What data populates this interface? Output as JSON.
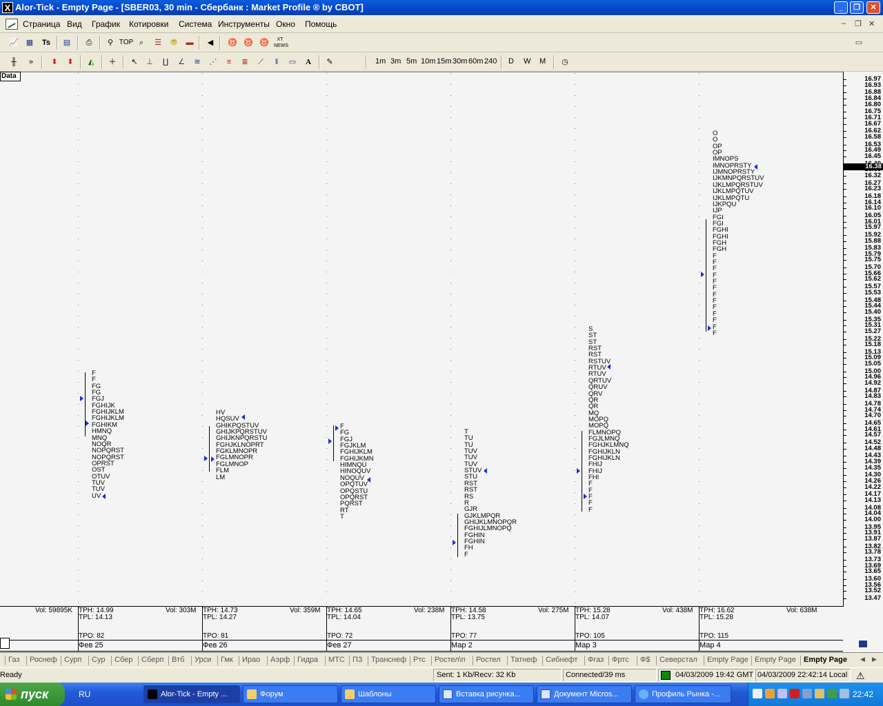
{
  "window": {
    "title": "Alor-Tick - Empty Page - [SBER03, 30 min - Сбербанк : Market Profile ® by CBOT]",
    "app_icon": "X"
  },
  "menu": [
    "Страница",
    "Вид",
    "График",
    "Котировки",
    "Система",
    "Инструменты",
    "Окно",
    "Помощь"
  ],
  "toolbar": {
    "top_label": "TOP",
    "timeframes": [
      "1m",
      "3m",
      "5m",
      "10m",
      "15m",
      "30m",
      "60m",
      "240",
      "D",
      "W",
      "M"
    ]
  },
  "chart": {
    "data_label": "Data",
    "price_labels": [
      "16.97",
      "16.93",
      "16.88",
      "16.84",
      "16.80",
      "16.75",
      "16.71",
      "16.67",
      "16.62",
      "16.58",
      "16.53",
      "16.49",
      "16.45",
      "16.40",
      "16.36",
      "16.32",
      "16.27",
      "16.23",
      "16.18",
      "16.14",
      "16.10",
      "16.05",
      "16.01",
      "15.97",
      "15.92",
      "15.88",
      "15.83",
      "15.79",
      "15.75",
      "15.70",
      "15.66",
      "15.62",
      "15.57",
      "15.53",
      "15.48",
      "15.44",
      "15.40",
      "15.35",
      "15.31",
      "15.27",
      "15.22",
      "15.18",
      "15.13",
      "15.09",
      "15.05",
      "15.00",
      "14.96",
      "14.92",
      "14.87",
      "14.83",
      "14.78",
      "14.74",
      "14.70",
      "14.65",
      "14.61",
      "14.57",
      "14.52",
      "14.48",
      "14.43",
      "14.39",
      "14.35",
      "14.30",
      "14.26",
      "14.22",
      "14.17",
      "14.13",
      "14.08",
      "14.04",
      "14.00",
      "13.95",
      "13.91",
      "13.87",
      "13.82",
      "13.78",
      "13.73",
      "13.69",
      "13.65",
      "13.60",
      "13.56",
      "13.52",
      "13.47"
    ],
    "current_price": "16.38",
    "profiles": [
      {
        "date": "Фев 25",
        "lines": [
          "F",
          "F",
          "FG",
          "FG",
          "FGJ",
          "FGHIJK",
          "FGHIJKLM",
          "FGHIJKLM",
          "FGHIKM",
          "HMNQ",
          "MNQ",
          "NOQR",
          "NOPQRST",
          "NOPQRST",
          "OPRST",
          "OST",
          "OTUV",
          "TUV",
          "TUV",
          "UV"
        ],
        "vol_day": "Vol: 59895K",
        "tph": "TPH: 14.99",
        "tpl": "TPL: 14.13",
        "vol": "Vol: 303M",
        "tpo": "TPO: 82"
      },
      {
        "date": "Фев 26",
        "lines": [
          "HV",
          "HQSUV",
          "GHIKPQSTUV",
          "GHIJKPQRSTUV",
          "GHIJKNPQRSTU",
          "FGHJKLNOPRT",
          "FGKLMNOPR",
          "FGLMNOPR",
          "FGLMNOP",
          "FLM",
          "LM"
        ],
        "tph": "TPH: 14.73",
        "tpl": "TPL: 14.27",
        "vol": "Vol: 359M",
        "tpo": "TPO: 81"
      },
      {
        "date": "Фев 27",
        "lines": [
          "F",
          "FG",
          "FGJ",
          "FGJKLM",
          "FGHIJKLM",
          "FGHIJKMN",
          "HIMNQU",
          "HINOQUV",
          "NOQUV",
          "OPQTUV",
          "OPQSTU",
          "OPQRST",
          "PQRST",
          "RT",
          "T"
        ],
        "tph": "TPH: 14.65",
        "tpl": "TPL: 14.04",
        "vol": "Vol: 238M",
        "tpo": "TPO: 72"
      },
      {
        "date": "Мар 2",
        "lines": [
          "T",
          "TU",
          "TU",
          "TUV",
          "TUV",
          "TUV",
          "STUV",
          "STU",
          "RST",
          "RST",
          "RS",
          "R",
          "GJR",
          "GJKLMPQR",
          "GHIJKLMNOPQR",
          "FGHIJLMNOPQ",
          "FGHIN",
          "FGHIN",
          "FH",
          "F"
        ],
        "tph": "TPH: 14.58",
        "tpl": "TPL: 13.75",
        "vol": "Vol: 275M",
        "tpo": "TPO: 77"
      },
      {
        "date": "Мар 3",
        "lines": [
          "S",
          "ST",
          "ST",
          "RST",
          "RST",
          "RSTUV",
          "RTUV",
          "RTUV",
          "QRTUV",
          "QRUV",
          "QRV",
          "QR",
          "QR",
          "MQ",
          "MOPQ",
          "MOPQ",
          "FLMNOPQ",
          "FGJLMNQ",
          "FGHJKLMNQ",
          "FGHIJKLN",
          "FGHIJKLN",
          "FHIJ",
          "FHIJ",
          "FHI",
          "F",
          "F",
          "F",
          "F",
          "F"
        ],
        "tph": "TPH: 15.28",
        "tpl": "TPL: 14.07",
        "vol": "Vol: 438M",
        "tpo": "TPO: 105"
      },
      {
        "date": "Мар 4",
        "lines": [
          "O",
          "O",
          "OP",
          "OP",
          "IMNOPS",
          "IMNOPRSTY",
          "IJMNOPRSTY",
          "IJKMNPQRSTUV",
          "IJKLMPQRSTUV",
          "IJKLMPQTUV",
          "IJKLMPQTU",
          "IJKPQU",
          "IJP",
          "FGI",
          "FGI",
          "FGHI",
          "FGHI",
          "FGH",
          "FGH",
          "F",
          "F",
          "F",
          "F",
          "F",
          "F",
          "F",
          "F",
          "F",
          "F",
          "F",
          "F",
          "F"
        ],
        "tph": "TPH: 16.62",
        "tpl": "TPL: 15.28",
        "vol": "Vol: 638M",
        "tpo": "TPO: 115"
      }
    ]
  },
  "tabs": [
    "Газ",
    "Роснеф",
    "Сурп",
    "Сур",
    "Сбер",
    "Сберп",
    "Втб",
    "Урси",
    "Гмк",
    "Ирао",
    "Аэрф",
    "Гидра",
    "МТС",
    "ПЗ",
    "Транснеф",
    "Ртс",
    "Ростел\\п",
    "Ростел",
    "Татнеф",
    "Сибнефт",
    "Фгаз",
    "Фртс",
    "Ф$",
    "Северстал",
    "Empty Page",
    "Empty Page",
    "Empty Page"
  ],
  "status": {
    "ready": "Ready",
    "traffic": "Sent: 1 Kb/Recv: 32 Kb",
    "connection": "Connected/39 ms",
    "gmt": "04/03/2009 19:42 GMT",
    "local": "04/03/2009 22:42:14 Local"
  },
  "taskbar": {
    "start": "пуск",
    "lang": "RU",
    "tasks": [
      "Alor-Tick - Empty ...",
      "Форум",
      "Шаблоны",
      "Вставка рисунка...",
      "Документ Micros...",
      "Профиль Рынка -..."
    ],
    "clock": "22:42"
  },
  "colors": {
    "title_bar": "#0546c7",
    "marker": "#1a2ad8",
    "chart_bg": "#f4f4f4",
    "taskbar": "#2459d6",
    "start": "#2f8a2c"
  }
}
